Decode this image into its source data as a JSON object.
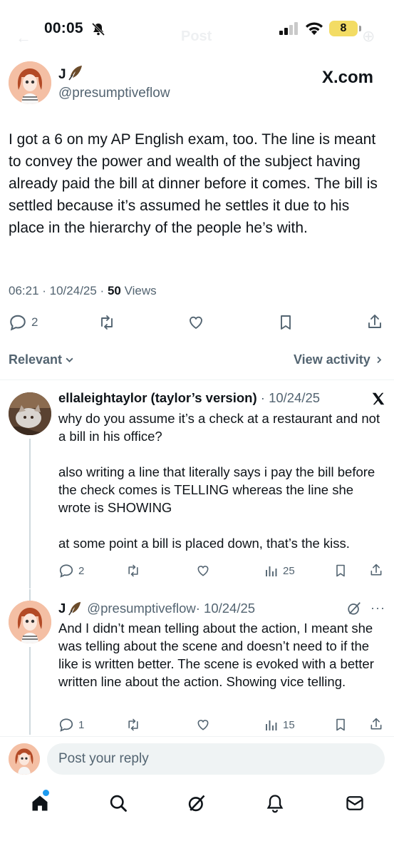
{
  "status_bar": {
    "time": "00:05",
    "battery": "8"
  },
  "header_ghost": {
    "title": "Post"
  },
  "post": {
    "name": "J",
    "handle": "@presumptiveflow",
    "source_label": "X.com",
    "text": "I got a 6 on my AP English exam, too. The line is meant to convey the power and wealth of the subject having already paid the bill at dinner before it comes. The bill is settled because it’s assumed he settles it due to his place in the hierarchy of the people he’s with.",
    "time": "06:21 · 10/24/25 ·",
    "views_count": "50",
    "views_label": "Views",
    "reply_count": "2"
  },
  "sort": {
    "label": "Relevant",
    "view_activity": "View activity"
  },
  "replies": [
    {
      "name": "ellaleightaylor (taylor’s version)",
      "date": "· 10/24/25",
      "text": "why do you assume it’s a check at a restaurant and not a bill in his office?\n\nalso writing a line that literally says i pay the bill before the check comes is TELLING whereas the line she wrote is SHOWING\n\nat some point a bill is placed down, that’s the kiss.",
      "reply_count": "2",
      "views": "25"
    },
    {
      "name": "J",
      "handle": "@presumptiveflow",
      "date": "· 10/24/25",
      "text": "And I didn’t mean telling about the action, I meant she was telling about the scene and doesn’t need to if the like is written better. The scene is evoked with a better written line about the action. Showing vice telling.",
      "reply_count": "1",
      "views": "15"
    }
  ],
  "composer": {
    "placeholder": "Post your reply"
  },
  "icons": [
    "reply-icon",
    "repost-icon",
    "like-icon",
    "bookmark-icon",
    "share-icon",
    "views-icon",
    "grok-icon",
    "home-icon",
    "search-icon",
    "notifications-icon",
    "messages-icon"
  ],
  "colors": {
    "accent": "#1d9bf0",
    "muted": "#536471",
    "text": "#0f1419",
    "battery": "#f3dc64"
  }
}
